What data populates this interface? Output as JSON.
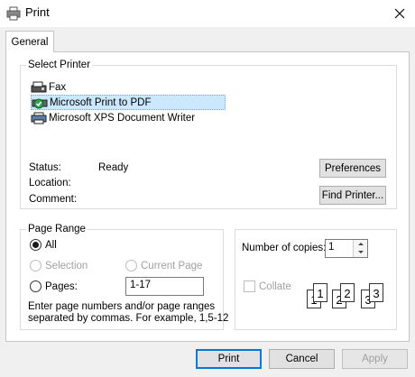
{
  "window": {
    "title": "Print"
  },
  "tabs": [
    {
      "label": "General"
    }
  ],
  "select_printer": {
    "legend": "Select Printer",
    "printers": [
      {
        "label": "Fax",
        "icon": "fax-icon"
      },
      {
        "label": "Microsoft Print to PDF",
        "icon": "printer-default-icon",
        "selected": true
      },
      {
        "label": "Microsoft XPS Document Writer",
        "icon": "printer-icon"
      }
    ],
    "status_label": "Status:",
    "status_value": "Ready",
    "location_label": "Location:",
    "location_value": "",
    "comment_label": "Comment:",
    "comment_value": "",
    "preferences_label": "Preferences",
    "find_printer_label": "Find Printer..."
  },
  "page_range": {
    "legend": "Page Range",
    "all_label": "All",
    "selection_label": "Selection",
    "current_page_label": "Current Page",
    "pages_label": "Pages:",
    "pages_value": "1-17",
    "hint_line1": "Enter page numbers and/or page ranges",
    "hint_line2": "separated by commas.  For example, 1,5-12"
  },
  "copies": {
    "label": "Number of copies:",
    "value": "1",
    "collate_label": "Collate",
    "pages": [
      "1",
      "1",
      "2",
      "2",
      "3",
      "3"
    ]
  },
  "buttons": {
    "print": "Print",
    "cancel": "Cancel",
    "apply": "Apply"
  },
  "colors": {
    "selection_bg": "#cce8ff",
    "default_button_border": "#0078d7",
    "disabled_text": "#a0a0a0"
  }
}
